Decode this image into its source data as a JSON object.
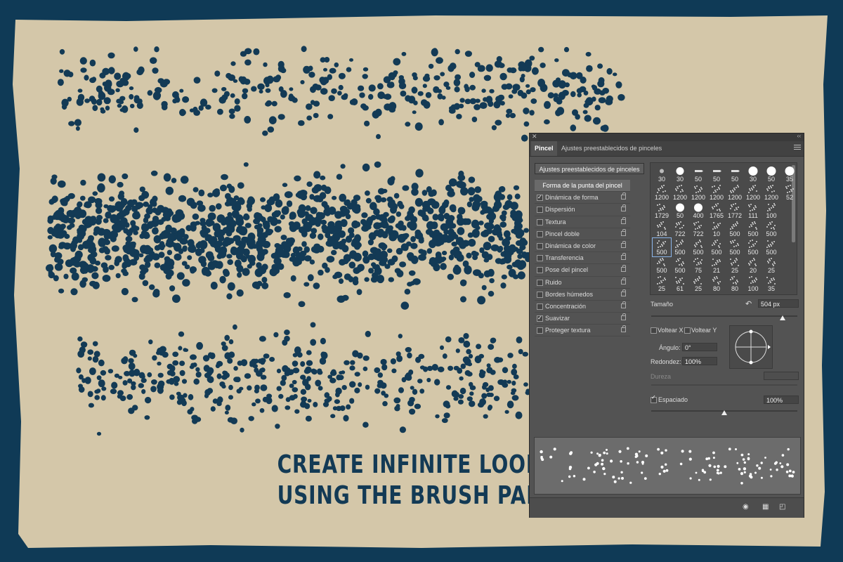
{
  "headline": {
    "line1": "CREATE INFINITE LOOKS",
    "line2": "USING THE BRUSH PANEL"
  },
  "colors": {
    "paper": "#d4c7a9",
    "ink": "#133a55",
    "frame": "#0f3a56",
    "panel_bg": "#535353"
  },
  "panel": {
    "close_icon": "close-icon",
    "collapse_icon": "double-chevron-icon",
    "tabs": [
      {
        "label": "Pincel",
        "active": true
      },
      {
        "label": "Ajustes preestablecidos de pinceles",
        "active": false
      }
    ],
    "presets_button": "Ajustes preestablecidos de pinceles",
    "settings": [
      {
        "label": "Forma de la punta del pincel",
        "header": true
      },
      {
        "label": "Dinámica de forma",
        "checked": true
      },
      {
        "label": "Dispersión",
        "checked": false
      },
      {
        "label": "Textura",
        "checked": false
      },
      {
        "label": "Pincel doble",
        "checked": false
      },
      {
        "label": "Dinámica de color",
        "checked": false
      },
      {
        "label": "Transferencia",
        "checked": false
      },
      {
        "label": "Pose del pincel",
        "checked": false
      },
      {
        "label": "Ruido",
        "checked": false
      },
      {
        "label": "Bordes húmedos",
        "checked": false
      },
      {
        "label": "Concentración",
        "checked": false
      },
      {
        "label": "Suavizar",
        "checked": true
      },
      {
        "label": "Proteger textura",
        "checked": false
      }
    ],
    "brush_sizes": [
      [
        "30",
        "30",
        "50",
        "50",
        "50",
        "30",
        "50",
        "35"
      ],
      [
        "1200",
        "1200",
        "1200",
        "1200",
        "1200",
        "1200",
        "1200",
        "52"
      ],
      [
        "1729",
        "50",
        "400",
        "1765",
        "1772",
        "111",
        "100",
        ""
      ],
      [
        "104",
        "722",
        "722",
        "10",
        "500",
        "500",
        "500",
        ""
      ],
      [
        "500",
        "500",
        "500",
        "500",
        "500",
        "500",
        "500",
        ""
      ],
      [
        "500",
        "500",
        "75",
        "21",
        "25",
        "20",
        "25",
        ""
      ],
      [
        "25",
        "61",
        "25",
        "80",
        "80",
        "100",
        "35",
        ""
      ]
    ],
    "selected_cell": [
      4,
      0
    ],
    "size_label": "Tamaño",
    "size_value": "504 px",
    "size_fraction": 0.9,
    "flip_x": "Voltear X",
    "flip_y": "Voltear Y",
    "angle_label": "Ángulo:",
    "angle_value": "0°",
    "roundness_label": "Redondez:",
    "roundness_value": "100%",
    "hardness_label": "Dureza",
    "spacing_label": "Espaciado",
    "spacing_checked": true,
    "spacing_value": "100%",
    "spacing_fraction": 0.5,
    "footer_icons": [
      "eye-toggle-icon",
      "create-preset-icon",
      "new-brush-icon"
    ]
  }
}
